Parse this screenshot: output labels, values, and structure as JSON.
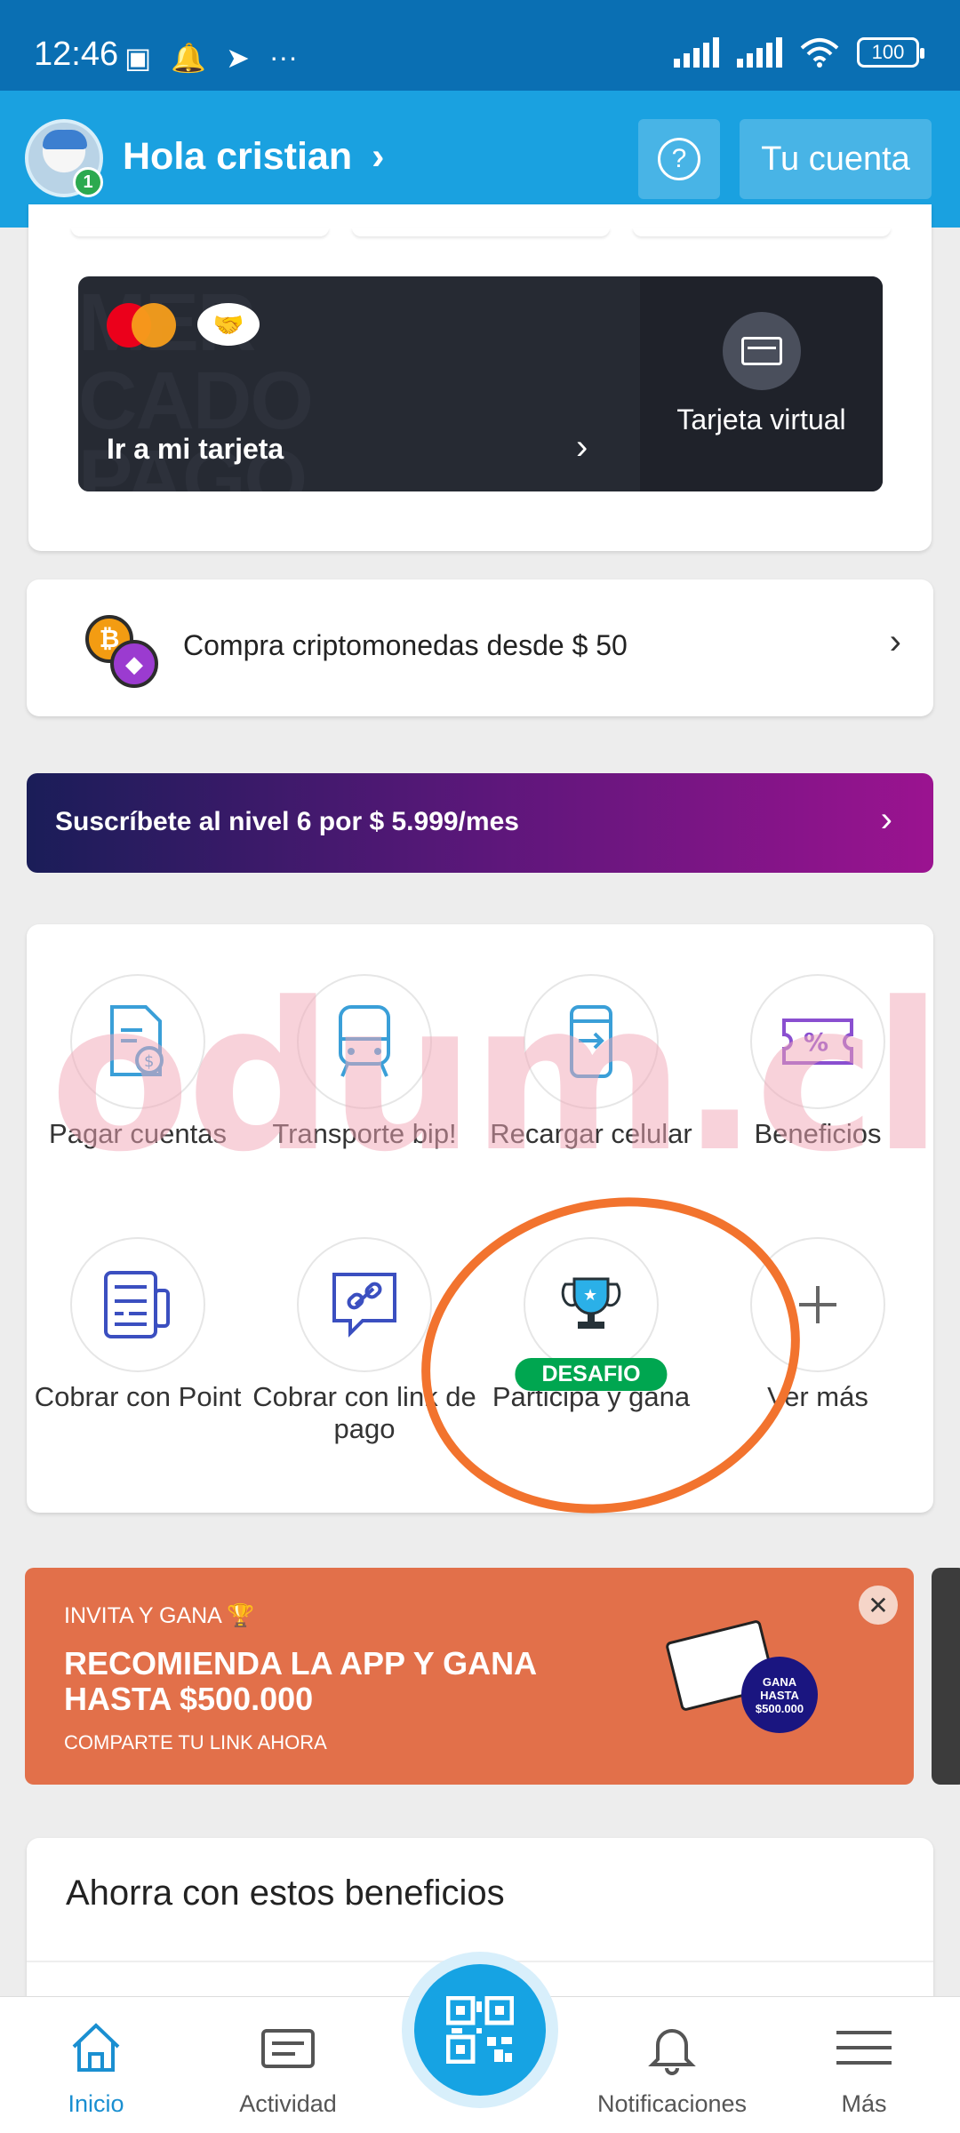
{
  "status_bar": {
    "time": "12:46",
    "dots": "···",
    "battery": "100"
  },
  "header": {
    "greeting": "Hola cristian",
    "greeting_chevron": "›",
    "avatar_badge": "1",
    "help_symbol": "?",
    "account_button": "Tu cuenta"
  },
  "card_widget": {
    "background_text": "MER\nCADO\nPAGO",
    "link_label": "Ir a mi tarjeta",
    "link_chevron": "›",
    "virtual_label": "Tarjeta virtual"
  },
  "crypto": {
    "label": "Compra criptomonedas desde $ 50",
    "chevron": "›"
  },
  "subscription": {
    "label": "Suscríbete al nivel 6 por $ 5.999/mes",
    "chevron": "›"
  },
  "shortcuts": [
    {
      "label": "Pagar cuentas"
    },
    {
      "label": "Transporte bip!"
    },
    {
      "label": "Recargar celular"
    },
    {
      "label": "Beneficios"
    },
    {
      "label": "Cobrar con Point"
    },
    {
      "label": "Cobrar con link de pago"
    },
    {
      "label": "Participa y gana",
      "badge": "DESAFIO"
    },
    {
      "label": "Ver más"
    }
  ],
  "watermark": "odum.cl",
  "invite": {
    "kicker": "INVITA Y GANA 🏆",
    "headline": "RECOMIENDA LA APP Y GANA HASTA $500.000",
    "sub": "COMPARTE TU LINK AHORA",
    "prize_line1": "GANA",
    "prize_line2": "HASTA",
    "prize_line3": "$500.000",
    "close": "✕"
  },
  "benefits": {
    "title": "Ahorra con estos beneficios"
  },
  "bottom_nav": [
    {
      "label": "Inicio",
      "active": true
    },
    {
      "label": "Actividad"
    },
    {
      "label": "Notificaciones"
    },
    {
      "label": "Más"
    }
  ],
  "colors": {
    "brand_blue": "#1aa1e0",
    "status_bar": "#0a6fb3",
    "accent_active": "#1a8fd1",
    "challenge_green": "#00a650",
    "invite_orange": "#e2704a",
    "annotation_orange": "#f2732e"
  }
}
